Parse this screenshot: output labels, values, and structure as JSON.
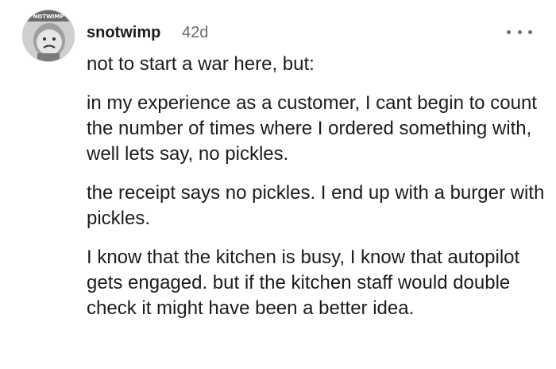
{
  "comment": {
    "author": {
      "username": "snotwimp",
      "avatar_icon": "user-avatar-icon",
      "avatar_badge_text": "NOTWIMP"
    },
    "timestamp": "42d",
    "overflow_menu_icon": "more-horizontal-icon",
    "paragraphs": [
      "not to start a war here, but:",
      "in my experience as a customer, I cant begin to count the number of times where I ordered something with, well lets say, no pickles.",
      "the receipt says no pickles. I end up with a burger with pickles.",
      "I know that the kitchen is busy, I know that autopilot gets engaged. but if the kitchen staff would double check it might have been a better idea."
    ]
  }
}
